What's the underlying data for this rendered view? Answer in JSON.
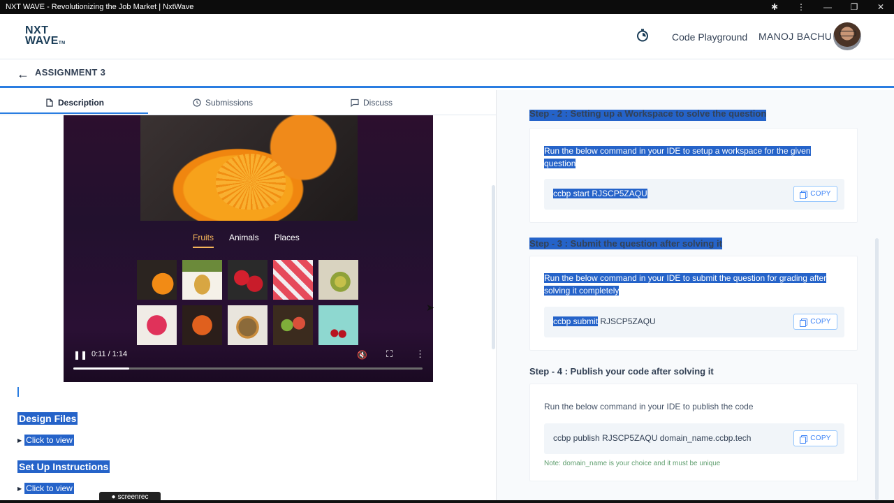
{
  "window": {
    "title": "NXT WAVE - Revolutionizing the Job Market | NxtWave",
    "controls": [
      "✱",
      "⋮",
      "—",
      "❐",
      "✕"
    ]
  },
  "header": {
    "logo_line1": "NXT",
    "logo_line2": "WAVE",
    "logo_tm": "TM",
    "code_playground": "Code Playground",
    "user_name": "MANOJ BACHU"
  },
  "assignment": {
    "back": "←",
    "title": "ASSIGNMENT 3"
  },
  "tabs": [
    {
      "label": "Description",
      "icon": "document-icon",
      "active": true
    },
    {
      "label": "Submissions",
      "icon": "clock-icon",
      "active": false
    },
    {
      "label": "Discuss",
      "icon": "chat-icon",
      "active": false
    }
  ],
  "video": {
    "tabs": [
      "Fruits",
      "Animals",
      "Places"
    ],
    "time": "0:11 / 1:14",
    "progress": 0.16
  },
  "left": {
    "design_files": "Design Files",
    "design_click": "Click to view",
    "setup": "Set Up Instructions",
    "setup_click": "Click to view"
  },
  "steps": {
    "step2_title": "Step - 2 : Setting up a Workspace to solve the question",
    "step2_desc": "Run the below command in your IDE to setup a workspace for the given question",
    "step2_cmd": "ccbp start RJSCP5ZAQU",
    "step3_title": "Step - 3 : Submit the question after solving it",
    "step3_desc": "Run the below command in your IDE to submit the question for grading after solving it completely",
    "step3_cmd_a": "ccbp submit",
    "step3_cmd_b": " RJSCP5ZAQU",
    "step4_title": "Step - 4 : Publish your code after solving it",
    "step4_desc": "Run the below command in your IDE to publish the code",
    "step4_cmd": "ccbp publish RJSCP5ZAQU domain_name.ccbp.tech",
    "step4_note": "Note: domain_name is your choice and it must be unique",
    "copy_label": "COPY"
  },
  "overlay": {
    "screenrec": "screenrec"
  },
  "colors": {
    "accent": "#2a7de1",
    "selection": "#2563c9",
    "video_bg": "#22112e"
  }
}
